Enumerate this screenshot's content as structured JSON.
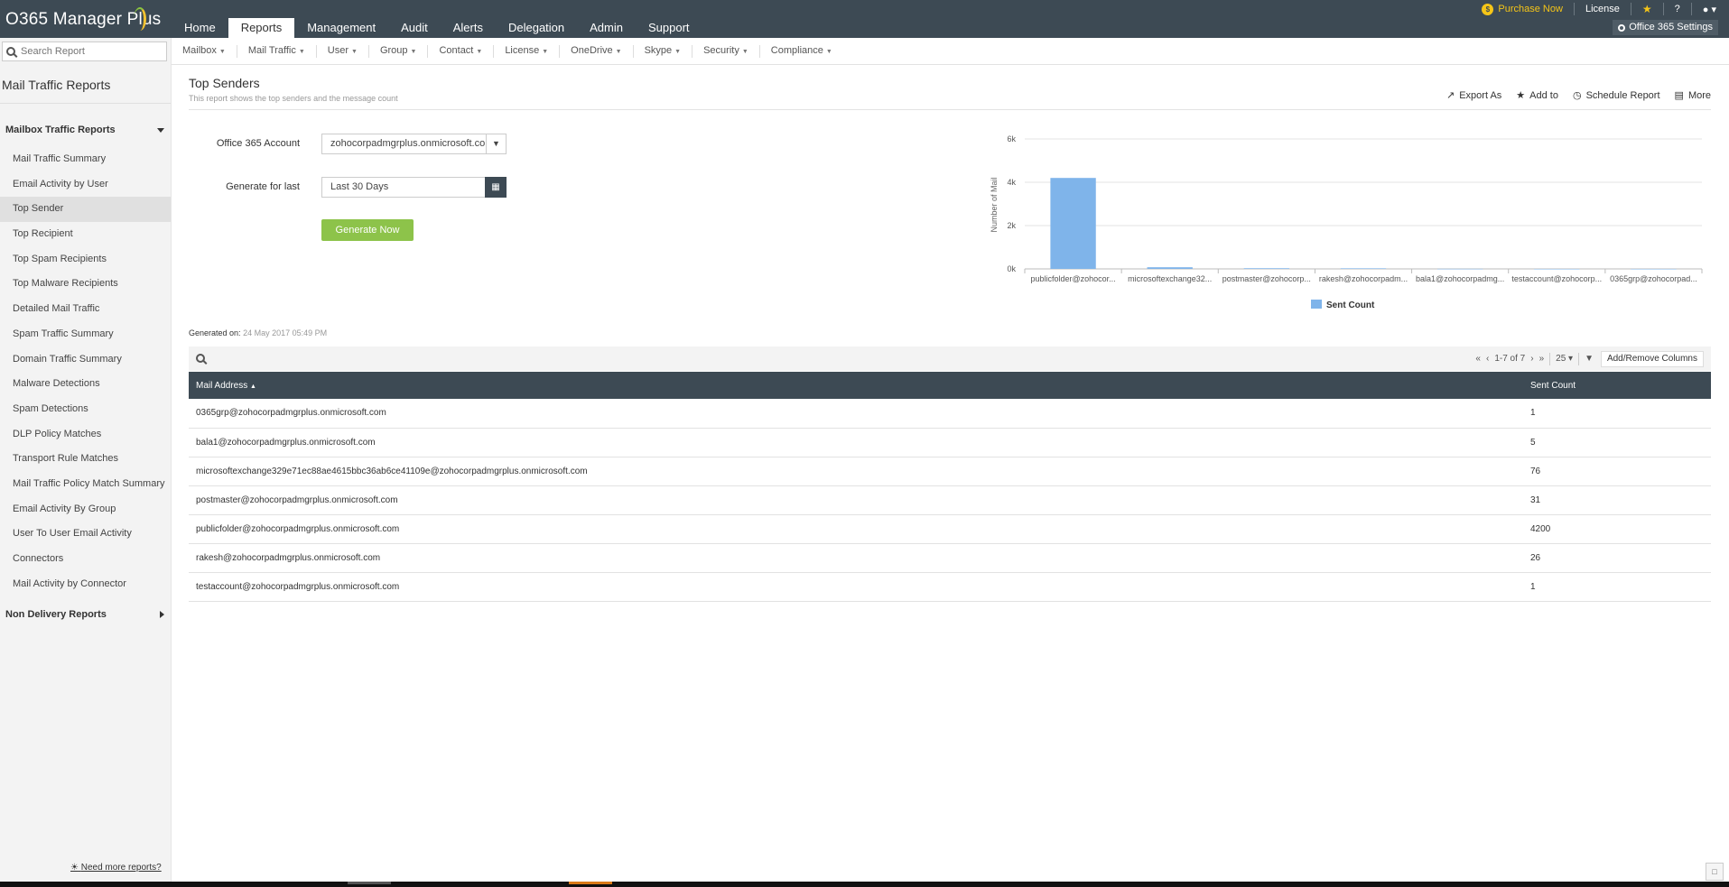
{
  "app": {
    "logo": "O365 Manager Plus"
  },
  "topnav": {
    "tabs": [
      {
        "label": "Home"
      },
      {
        "label": "Reports"
      },
      {
        "label": "Management"
      },
      {
        "label": "Audit"
      },
      {
        "label": "Alerts"
      },
      {
        "label": "Delegation"
      },
      {
        "label": "Admin"
      },
      {
        "label": "Support"
      }
    ],
    "active_tab": "Reports"
  },
  "topright": {
    "purchase": "Purchase Now",
    "license": "License",
    "help": "?",
    "settings": "Office 365 Settings"
  },
  "subnav": {
    "items": [
      {
        "label": "Mailbox"
      },
      {
        "label": "Mail Traffic"
      },
      {
        "label": "User"
      },
      {
        "label": "Group"
      },
      {
        "label": "Contact"
      },
      {
        "label": "License"
      },
      {
        "label": "OneDrive"
      },
      {
        "label": "Skype"
      },
      {
        "label": "Security"
      },
      {
        "label": "Compliance"
      }
    ]
  },
  "sidebar": {
    "search_placeholder": "Search Report",
    "title": "Mail Traffic Reports",
    "group1": "Mailbox Traffic Reports",
    "group2": "Non Delivery Reports",
    "items": [
      {
        "label": "Mail Traffic Summary"
      },
      {
        "label": "Email Activity by User"
      },
      {
        "label": "Top Sender"
      },
      {
        "label": "Top Recipient"
      },
      {
        "label": "Top Spam Recipients"
      },
      {
        "label": "Top Malware Recipients"
      },
      {
        "label": "Detailed Mail Traffic"
      },
      {
        "label": "Spam Traffic Summary"
      },
      {
        "label": "Domain Traffic Summary"
      },
      {
        "label": "Malware Detections"
      },
      {
        "label": "Spam Detections"
      },
      {
        "label": "DLP Policy Matches"
      },
      {
        "label": "Transport Rule Matches"
      },
      {
        "label": "Mail Traffic Policy Match Summary"
      },
      {
        "label": "Email Activity By Group"
      },
      {
        "label": "User To User Email Activity"
      },
      {
        "label": "Connectors"
      },
      {
        "label": "Mail Activity by Connector"
      }
    ],
    "active_item": "Top Sender",
    "need_more": "Need more reports?"
  },
  "main": {
    "title": "Top Senders",
    "description": "This report shows the top senders and the message count",
    "actions": {
      "export": "Export As",
      "add_to": "Add to",
      "schedule": "Schedule Report",
      "more": "More"
    },
    "form": {
      "account_label": "Office 365 Account",
      "account_value": "zohocorpadmgrplus.onmicrosoft.com",
      "period_label": "Generate for last",
      "period_value": "Last 30 Days",
      "generate_button": "Generate Now"
    },
    "generated_label": "Generated on:",
    "generated_value": "24 May 2017 05:49 PM",
    "pager": {
      "range": "1-7 of 7",
      "per_page": "25"
    },
    "add_remove_columns": "Add/Remove Columns",
    "table": {
      "headers": [
        "Mail Address",
        "Sent Count"
      ],
      "rows": [
        [
          "0365grp@zohocorpadmgrplus.onmicrosoft.com",
          "1"
        ],
        [
          "bala1@zohocorpadmgrplus.onmicrosoft.com",
          "5"
        ],
        [
          "microsoftexchange329e71ec88ae4615bbc36ab6ce41109e@zohocorpadmgrplus.onmicrosoft.com",
          "76"
        ],
        [
          "postmaster@zohocorpadmgrplus.onmicrosoft.com",
          "31"
        ],
        [
          "publicfolder@zohocorpadmgrplus.onmicrosoft.com",
          "4200"
        ],
        [
          "rakesh@zohocorpadmgrplus.onmicrosoft.com",
          "26"
        ],
        [
          "testaccount@zohocorpadmgrplus.onmicrosoft.com",
          "1"
        ]
      ]
    }
  },
  "chart_data": {
    "type": "bar",
    "categories": [
      "publicfolder@zohocor...",
      "microsoftexchange32...",
      "postmaster@zohocorp...",
      "rakesh@zohocorpadm...",
      "bala1@zohocorpadmg...",
      "testaccount@zohocorp...",
      "0365grp@zohocorpad..."
    ],
    "values": [
      4200,
      76,
      31,
      26,
      5,
      1,
      1
    ],
    "series": [
      {
        "name": "Sent Count",
        "values": [
          4200,
          76,
          31,
          26,
          5,
          1,
          1
        ]
      }
    ],
    "ylabel": "Number of Mail",
    "yticks": [
      "0k",
      "2k",
      "4k",
      "6k"
    ],
    "ylim": [
      0,
      6000
    ],
    "grid": true,
    "legend": "bottom",
    "bar_color": "#7fb4ea"
  }
}
